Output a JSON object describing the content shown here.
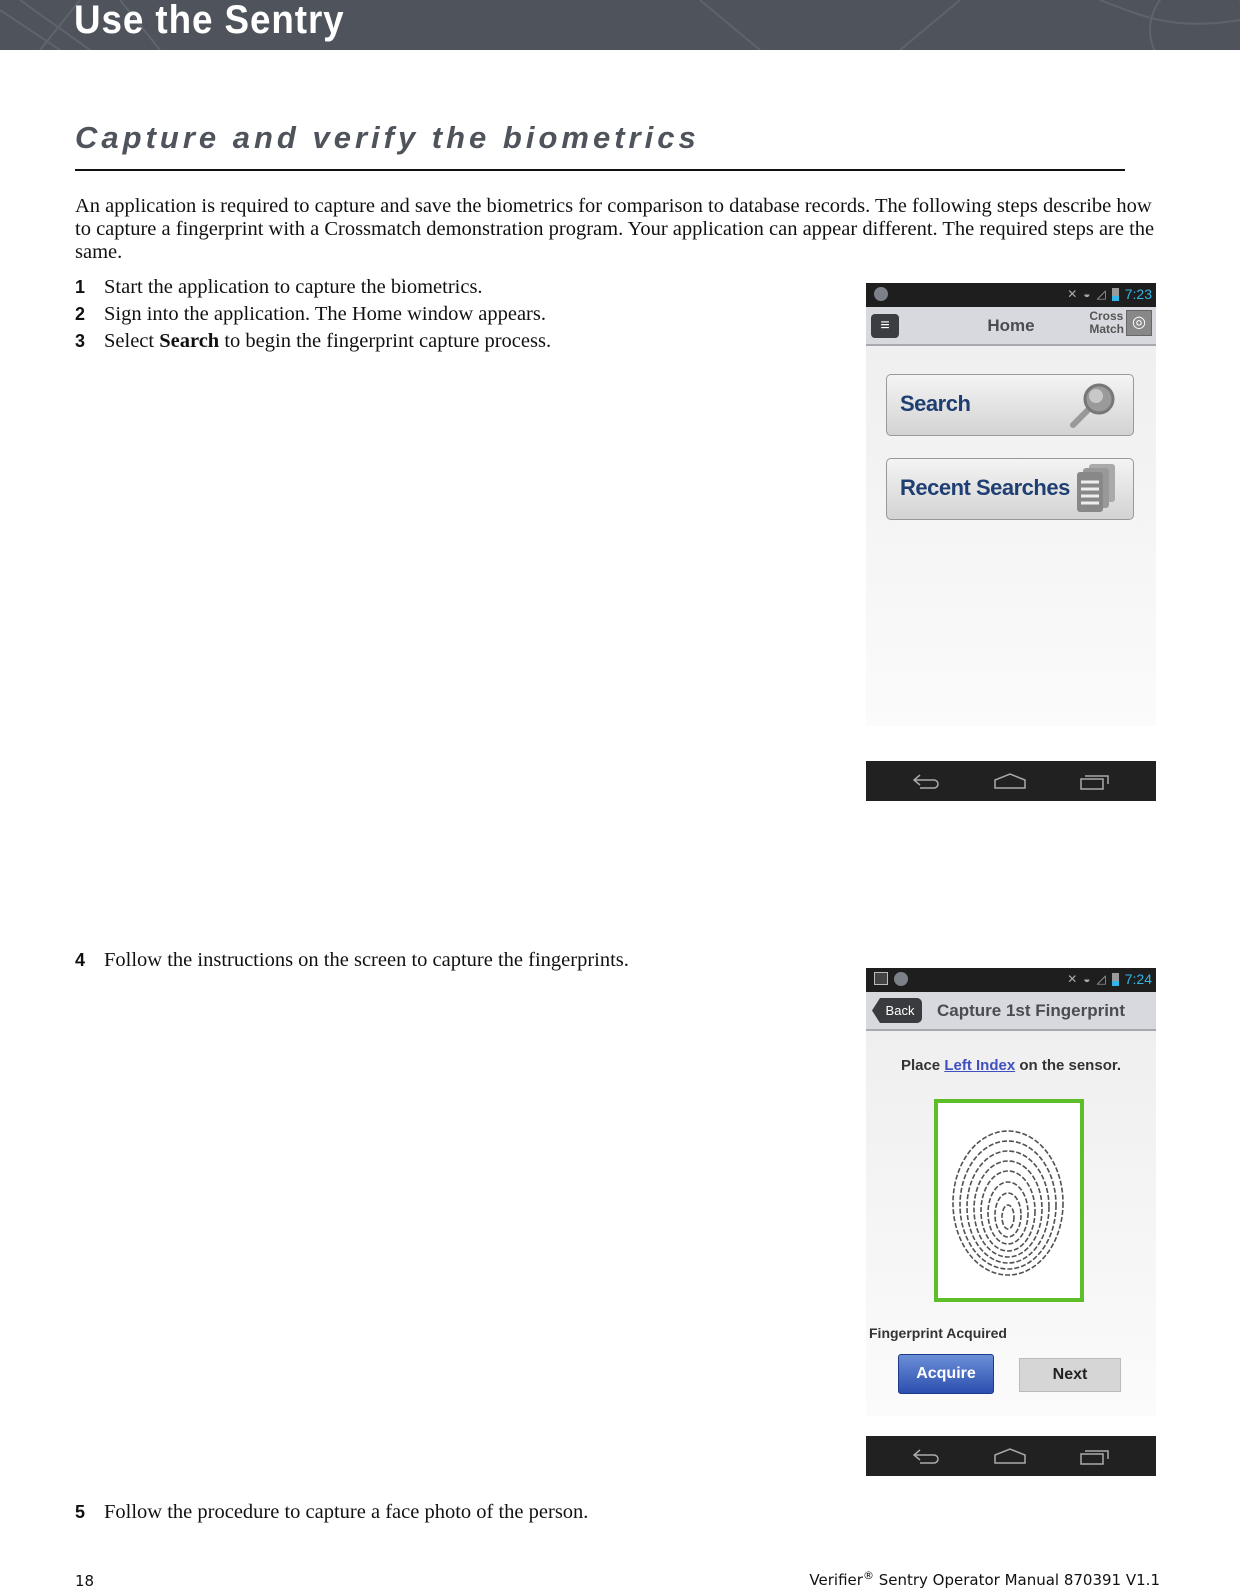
{
  "banner": {
    "title": "Use the Sentry"
  },
  "section": {
    "title": "Capture and verify the biometrics"
  },
  "intro": "An application is required to capture and save the biometrics for comparison to database records. The following steps describe how to capture a fingerprint with a Crossmatch demonstration program. Your application can appear different. The required steps are the same.",
  "steps": [
    {
      "num": "1",
      "text": "Start the application to capture the biometrics."
    },
    {
      "num": "2",
      "text": "Sign into the application. The Home window appears."
    },
    {
      "num": "3",
      "text_before": "Select ",
      "bold": "Search",
      "text_after": " to begin the fingerprint capture process."
    },
    {
      "num": "4",
      "text": "Follow the instructions on the screen to capture the fingerprints."
    },
    {
      "num": "5",
      "text": "Follow the procedure to capture a face photo of the person."
    }
  ],
  "screen_home": {
    "time": "7:23",
    "title": "Home",
    "logo_line1": "Cross",
    "logo_line2": "Match",
    "buttons": [
      {
        "label": "Search",
        "icon": "magnifier-icon"
      },
      {
        "label": "Recent Searches",
        "icon": "document-stack-icon"
      }
    ]
  },
  "screen_capture": {
    "time": "7:24",
    "back_label": "Back",
    "title": "Capture 1st Fingerprint",
    "instruction_before": "Place ",
    "finger": "Left Index",
    "instruction_after": " on the sensor.",
    "status": "Fingerprint Acquired",
    "acquire_label": "Acquire",
    "next_label": "Next",
    "frame_color": "#5cbf2a"
  },
  "colors": {
    "banner": "#4f535b",
    "accent_time": "#33b5e5",
    "button_text": "#1f3f72"
  },
  "footer": {
    "page": "18",
    "product": "Verifier",
    "reg": "®",
    "rest": " Sentry Operator Manual 870391 V1.1"
  }
}
